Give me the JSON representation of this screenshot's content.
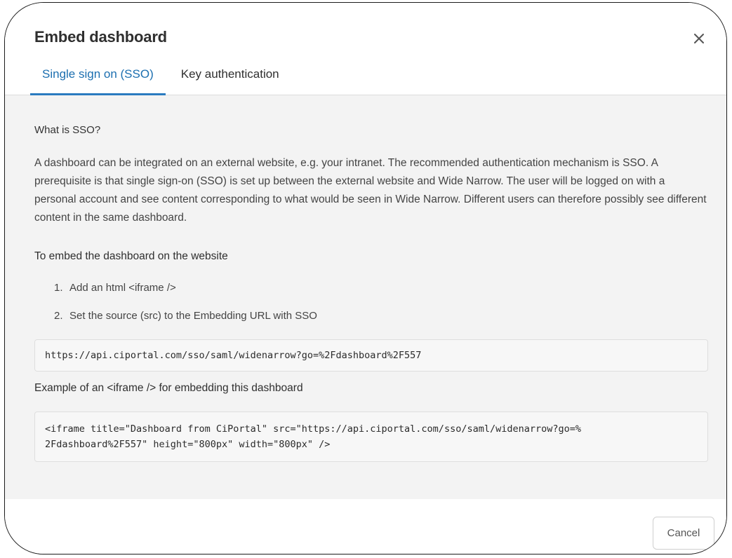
{
  "dialog": {
    "title": "Embed dashboard",
    "close_icon": "close-icon"
  },
  "tabs": [
    {
      "label": "Single sign on (SSO)",
      "active": true
    },
    {
      "label": "Key authentication",
      "active": false
    }
  ],
  "sso": {
    "what_is_heading": "What is SSO?",
    "description": "A dashboard can be integrated on an external website, e.g. your intranet. The recommended authentication mechanism is SSO. A prerequisite is that single sign-on (SSO) is set up between the external website and Wide Narrow. The user will be logged on with a personal account and see content corresponding to what would be seen in Wide Narrow. Different users can therefore possibly see different content in the same dashboard.",
    "embed_heading": "To embed the dashboard on the website",
    "steps": [
      {
        "num": "1.",
        "text": "Add an html <iframe />"
      },
      {
        "num": "2.",
        "text": "Set the source (src) to the Embedding URL with SSO"
      }
    ],
    "embedding_url": "https://api.ciportal.com/sso/saml/widenarrow?go=%2Fdashboard%2F557",
    "example_heading": "Example of an <iframe /> for embedding this dashboard",
    "iframe_code_lines": [
      "<iframe title=\"Dashboard from CiPortal\" src=\"https://api.ciportal.com/sso/saml/widenarrow?go=%",
      "2Fdashboard%2F557\" height=\"800px\" width=\"800px\" />"
    ]
  },
  "footer": {
    "cancel_label": "Cancel"
  },
  "colors": {
    "accent": "#2a7bbf",
    "body_background": "#f3f3f3",
    "code_background": "#f7f7f7"
  }
}
